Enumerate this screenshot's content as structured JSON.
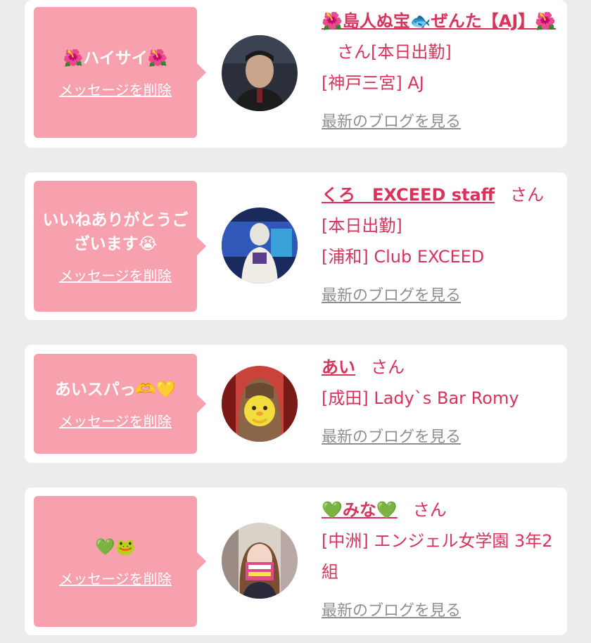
{
  "delete_label": "メッセージを削除",
  "blog_label": "最新のブログを見る",
  "colors": {
    "bubble": "#f8a1ae",
    "accent": "#d8335a",
    "link_gray": "#8f8f8f"
  },
  "cards": [
    {
      "message": "🌺ハイサイ🌺",
      "name": "🌺島人ぬ宝🐟ぜんた【AJ】🌺",
      "suffix": "さん[本日出勤]",
      "shop": "[神戸三宮] AJ"
    },
    {
      "message": "いいねありがとうございます😭",
      "name": "くろ　EXCEED staff",
      "suffix": "さん[本日出勤]",
      "shop": "[浦和] Club EXCEED"
    },
    {
      "message": "あいスパっ🫶💛",
      "name": "あい",
      "suffix": "さん",
      "shop": "[成田] Lady`s Bar Romy"
    },
    {
      "message": "💚🐸",
      "name": "💚みな💚",
      "suffix": "さん",
      "shop": "[中洲] エンジェル女学園 3年2組"
    }
  ]
}
